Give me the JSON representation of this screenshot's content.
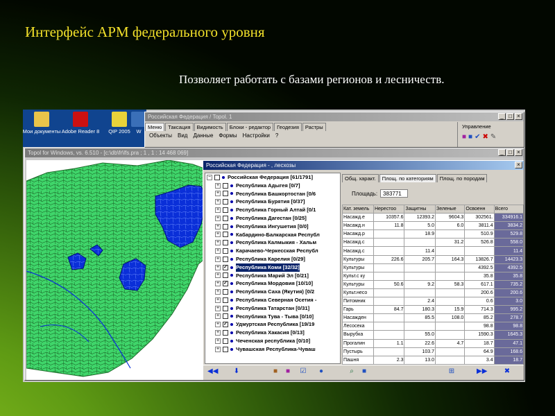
{
  "slide": {
    "title": "Интерфейс АРМ федерального уровня",
    "subtitle": "Позволяет работать с базами регионов и лесничеств."
  },
  "desktop_icons": [
    {
      "label": "Мои документы",
      "icon": "folder-icon",
      "color": "#e8c44a"
    },
    {
      "label": "Adobe Reader 8",
      "icon": "pdf-icon",
      "color": "#cc1111"
    },
    {
      "label": "QIP 2005",
      "icon": "flower-icon",
      "color": "#e8d23a"
    },
    {
      "label": "W",
      "icon": "app-icon",
      "color": "#3a6fb8"
    }
  ],
  "main_window": {
    "title": "Российская Федерация / Topol. 1",
    "tabs": [
      "Меню",
      "Таксация",
      "Видимость",
      "Блоки - редактор",
      "Геодезия",
      "Растры"
    ],
    "menu": [
      "Объекты",
      "Вид",
      "Данные",
      "Формы",
      "Настройки",
      "?"
    ],
    "panel_label": "Управление"
  },
  "map_window": {
    "title": "Topol for Windows, vs. 6.510 - [c:\\db\\fr\\lfs.pra ; 1 , 1 : 14 468 069]"
  },
  "data_window": {
    "title": "Российская Федерация - , лесхозы",
    "tree_root": "Российская Федерация [61/1791]",
    "tree": [
      {
        "label": "Республика Адыгея [0/7]",
        "checked": false
      },
      {
        "label": "Республика Башкортостан [0/6",
        "checked": false
      },
      {
        "label": "Республика Бурятия [0/37]",
        "checked": false
      },
      {
        "label": "Республика Горный Алтай [0/1",
        "checked": false
      },
      {
        "label": "Республика Дагестан [0/25]",
        "checked": false
      },
      {
        "label": "Республика Ингушетия [0/0]",
        "checked": false
      },
      {
        "label": "Кабардино-Балкарская Республ",
        "checked": false
      },
      {
        "label": "Республика Калмыкия - Хальм",
        "checked": false
      },
      {
        "label": "Карачаево-Черкесская Республ",
        "checked": false
      },
      {
        "label": "Республика Карелия [0/29]",
        "checked": false
      },
      {
        "label": "Республика Коми [32/32]",
        "checked": true,
        "selected": true
      },
      {
        "label": "Республика Марий Эл [0/21]",
        "checked": false
      },
      {
        "label": "Республика Мордовия [10/10]",
        "checked": true
      },
      {
        "label": "Республика Саха (Якутия) [0/2",
        "checked": false
      },
      {
        "label": "Республика Северная Осетия -",
        "checked": false
      },
      {
        "label": "Республика Татарстан [0/31]",
        "checked": false
      },
      {
        "label": "Республика Тува - Тыва [0/10]",
        "checked": false
      },
      {
        "label": "Удмуртская Республика [19/19",
        "checked": true
      },
      {
        "label": "Республика Хакасия [0/13]",
        "checked": false
      },
      {
        "label": "Чеченская республика [0/10]",
        "checked": false
      },
      {
        "label": "Чувашская Республика-Чуваш",
        "checked": false
      }
    ],
    "tabs": [
      "Общ. характ.",
      "Площ. по категориям",
      "Площ. по породам"
    ],
    "area_label": "Площадь:",
    "area_value": "383771",
    "columns": [
      "Кат. земель",
      "Нерестоо",
      "Защитны",
      "Зеленые",
      "Освоенн",
      "Всего"
    ],
    "rows": [
      [
        "Насажд.е",
        "10357.6",
        "12393.2",
        "9604.3",
        "302561.",
        "334916.1"
      ],
      [
        "Насажд.н",
        "11.8",
        "5.0",
        "6.0",
        "3811.4",
        "3834.2"
      ],
      [
        "Насажд.р",
        "",
        "18.9",
        "",
        "510.9",
        "529.8"
      ],
      [
        "Насажд.с",
        "",
        "",
        "31.2",
        "526.8",
        "558.0"
      ],
      [
        "Насажд.с",
        "",
        "11.4",
        "",
        "",
        "11.4"
      ],
      [
        "Культуры",
        "226.6",
        "205.7",
        "164.3",
        "13826.7",
        "14423.3"
      ],
      [
        "Культуры",
        "",
        "",
        "",
        "4392.5",
        "4392.5"
      ],
      [
        "Культ.с ку",
        "",
        "",
        "",
        "35.8",
        "35.8"
      ],
      [
        "Культуры",
        "50.6",
        "9.2",
        "58.3",
        "617.1",
        "735.2"
      ],
      [
        "Культ.несо",
        "",
        "",
        "",
        "200.6",
        "200.6"
      ],
      [
        "Питомник",
        "",
        "2.4",
        "",
        "0.6",
        "3.0"
      ],
      [
        "Гарь",
        "84.7",
        "180.3",
        "15.9",
        "714.3",
        "995.2"
      ],
      [
        "Насажден",
        "",
        "85.5",
        "108.0",
        "85.2",
        "278.7"
      ],
      [
        "Лесосека",
        "",
        "",
        "",
        "98.8",
        "98.8"
      ],
      [
        "Вырубка",
        "",
        "55.0",
        "",
        "1590.3",
        "1645.3"
      ],
      [
        "Прогалин",
        "1.1",
        "22.6",
        "4.7",
        "18.7",
        "47.1"
      ],
      [
        "Пустырь",
        "",
        "103.7",
        "",
        "64.9",
        "168.6"
      ],
      [
        "Пашня",
        "2.3",
        "13.0",
        "",
        "3.4",
        "18.7"
      ]
    ]
  },
  "colors": {
    "accent_title": "#f2e02a",
    "selected_region": "#0a2fd8",
    "map_fill": "#3fd56a"
  }
}
